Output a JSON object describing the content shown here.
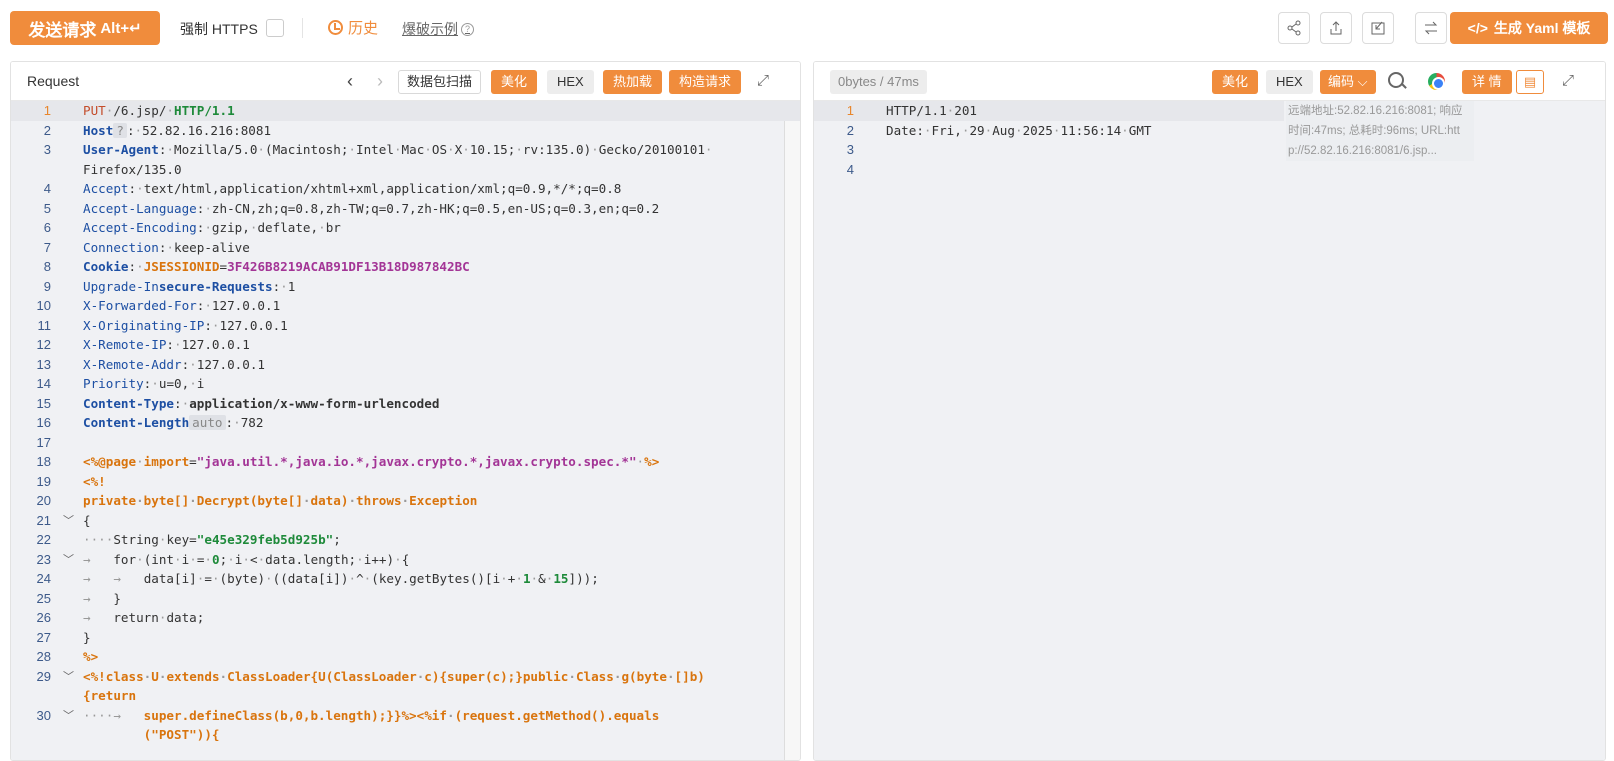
{
  "toolbar": {
    "send_label": "发送请求",
    "send_shortcut": "Alt+↵",
    "https_label": "强制 HTTPS",
    "history_label": "历史",
    "blast_label": "爆破示例",
    "yaml_label": "生成 Yaml 模板"
  },
  "request": {
    "title": "Request",
    "scan_label": "数据包扫描",
    "beautify_label": "美化",
    "hex_label": "HEX",
    "hotload_label": "热加载",
    "construct_label": "构造请求"
  },
  "response": {
    "timing": "0bytes / 47ms",
    "beautify_label": "美化",
    "hex_label": "HEX",
    "encoding_label": "编码",
    "detail_label": "详 情",
    "meta_line1": "远端地址:52.82.16.216:8081; 响应",
    "meta_line2": "时间:47ms; 总耗时:96ms; URL:htt",
    "meta_line3": "p://52.82.16.216:8081/6.jsp..."
  },
  "request_lines": [
    "1",
    "2",
    "3",
    "",
    "4",
    "5",
    "6",
    "7",
    "8",
    "9",
    "10",
    "11",
    "12",
    "13",
    "14",
    "15",
    "16",
    "17",
    "18",
    "19",
    "20",
    "21",
    "22",
    "23",
    "24",
    "25",
    "26",
    "27",
    "28",
    "29",
    "",
    "30",
    ""
  ],
  "response_lines": [
    "1",
    "2",
    "3",
    "4"
  ],
  "colors": {
    "accent": "#f08c3c",
    "editor_bg": "#f0f1f4"
  }
}
